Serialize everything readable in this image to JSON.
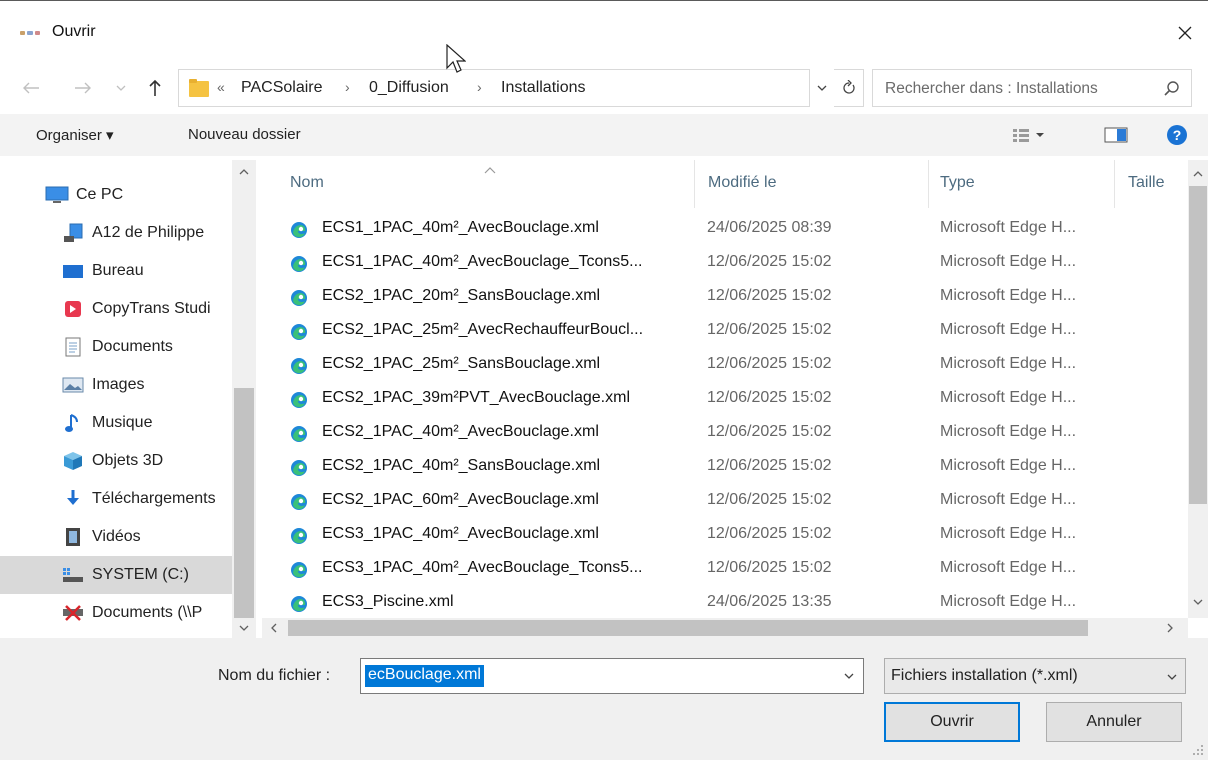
{
  "window": {
    "title": "Ouvrir",
    "close_icon": "close-icon"
  },
  "navigation": {
    "back_icon": "arrow-left-icon",
    "forward_icon": "arrow-right-icon",
    "recent_icon": "chevron-down-icon",
    "up_icon": "arrow-up-icon",
    "breadcrumb": {
      "overflow": "«",
      "items": [
        "PACSolaire",
        "0_Diffusion",
        "Installations"
      ],
      "separator": "›"
    },
    "search_placeholder": "Rechercher dans : Installations"
  },
  "toolbar": {
    "organize_label": "Organiser ▾",
    "new_folder_label": "Nouveau dossier",
    "view_icon": "view-options-icon",
    "preview_icon": "preview-pane-icon",
    "help_icon": "help-icon"
  },
  "sidebar": {
    "items": [
      {
        "label": "Ce PC",
        "icon": "computer-icon"
      },
      {
        "label": "A12 de Philippe",
        "icon": "device-icon"
      },
      {
        "label": "Bureau",
        "icon": "desktop-icon"
      },
      {
        "label": "CopyTrans Studi",
        "icon": "copytrans-icon"
      },
      {
        "label": "Documents",
        "icon": "documents-icon"
      },
      {
        "label": "Images",
        "icon": "images-icon"
      },
      {
        "label": "Musique",
        "icon": "music-icon"
      },
      {
        "label": "Objets 3D",
        "icon": "objects3d-icon"
      },
      {
        "label": "Téléchargements",
        "icon": "downloads-icon"
      },
      {
        "label": "Vidéos",
        "icon": "videos-icon"
      },
      {
        "label": "SYSTEM (C:)",
        "icon": "drive-icon"
      },
      {
        "label": "Documents (\\\\P",
        "icon": "network-drive-icon"
      }
    ]
  },
  "file_list": {
    "columns": {
      "name": "Nom",
      "modified": "Modifié le",
      "type": "Type",
      "size": "Taille"
    },
    "sort_icon": "sort-up-icon",
    "files": [
      {
        "name": "ECS1_1PAC_40m²_AvecBouclage.xml",
        "modified": "24/06/2025 08:39",
        "type": "Microsoft Edge H..."
      },
      {
        "name": "ECS1_1PAC_40m²_AvecBouclage_Tcons5...",
        "modified": "12/06/2025 15:02",
        "type": "Microsoft Edge H..."
      },
      {
        "name": "ECS2_1PAC_20m²_SansBouclage.xml",
        "modified": "12/06/2025 15:02",
        "type": "Microsoft Edge H..."
      },
      {
        "name": "ECS2_1PAC_25m²_AvecRechauffeurBoucl...",
        "modified": "12/06/2025 15:02",
        "type": "Microsoft Edge H..."
      },
      {
        "name": "ECS2_1PAC_25m²_SansBouclage.xml",
        "modified": "12/06/2025 15:02",
        "type": "Microsoft Edge H..."
      },
      {
        "name": "ECS2_1PAC_39m²PVT_AvecBouclage.xml",
        "modified": "12/06/2025 15:02",
        "type": "Microsoft Edge H..."
      },
      {
        "name": "ECS2_1PAC_40m²_AvecBouclage.xml",
        "modified": "12/06/2025 15:02",
        "type": "Microsoft Edge H..."
      },
      {
        "name": "ECS2_1PAC_40m²_SansBouclage.xml",
        "modified": "12/06/2025 15:02",
        "type": "Microsoft Edge H..."
      },
      {
        "name": "ECS2_1PAC_60m²_AvecBouclage.xml",
        "modified": "12/06/2025 15:02",
        "type": "Microsoft Edge H..."
      },
      {
        "name": "ECS3_1PAC_40m²_AvecBouclage.xml",
        "modified": "12/06/2025 15:02",
        "type": "Microsoft Edge H..."
      },
      {
        "name": "ECS3_1PAC_40m²_AvecBouclage_Tcons5...",
        "modified": "12/06/2025 15:02",
        "type": "Microsoft Edge H..."
      },
      {
        "name": "ECS3_Piscine.xml",
        "modified": "24/06/2025 13:35",
        "type": "Microsoft Edge H..."
      }
    ],
    "file_icon": "edge-file-icon"
  },
  "footer": {
    "filename_label": "Nom du fichier :",
    "filename_value": "ecBouclage.xml",
    "filter_value": "Fichiers installation (*.xml)",
    "open_label": "Ouvrir",
    "cancel_label": "Annuler"
  },
  "colors": {
    "accent": "#0078d7",
    "header_text": "#4d6b80",
    "toolbar_bg": "#f3f3f3",
    "footer_bg": "#f0f0f0",
    "selected_bg": "#d9d9d9"
  }
}
